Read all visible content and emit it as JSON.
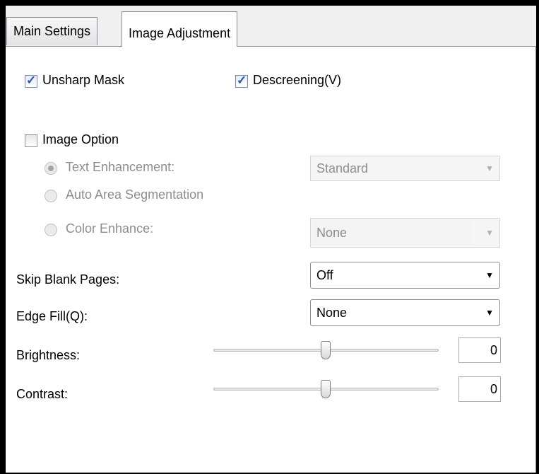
{
  "tabs": [
    {
      "label": "Main Settings",
      "active": false
    },
    {
      "label": "Image Adjustment",
      "active": true
    }
  ],
  "options": {
    "unsharp_mask": {
      "label": "Unsharp Mask",
      "checked": true
    },
    "descreening": {
      "label": "Descreening(V)",
      "checked": true
    },
    "image_option": {
      "label": "Image Option",
      "checked": false
    }
  },
  "image_option_modes": {
    "text_enhancement": {
      "label": "Text Enhancement:",
      "selected": true,
      "enabled": false,
      "value": "Standard"
    },
    "auto_area_segmentation": {
      "label": "Auto Area Segmentation",
      "selected": false,
      "enabled": false
    },
    "color_enhance": {
      "label": "Color Enhance:",
      "selected": false,
      "enabled": false,
      "value": "None"
    }
  },
  "skip_blank_pages": {
    "label": "Skip Blank Pages:",
    "value": "Off"
  },
  "edge_fill": {
    "label": "Edge Fill(Q):",
    "value": "None"
  },
  "brightness": {
    "label": "Brightness:",
    "value": "0"
  },
  "contrast": {
    "label": "Contrast:",
    "value": "0"
  }
}
